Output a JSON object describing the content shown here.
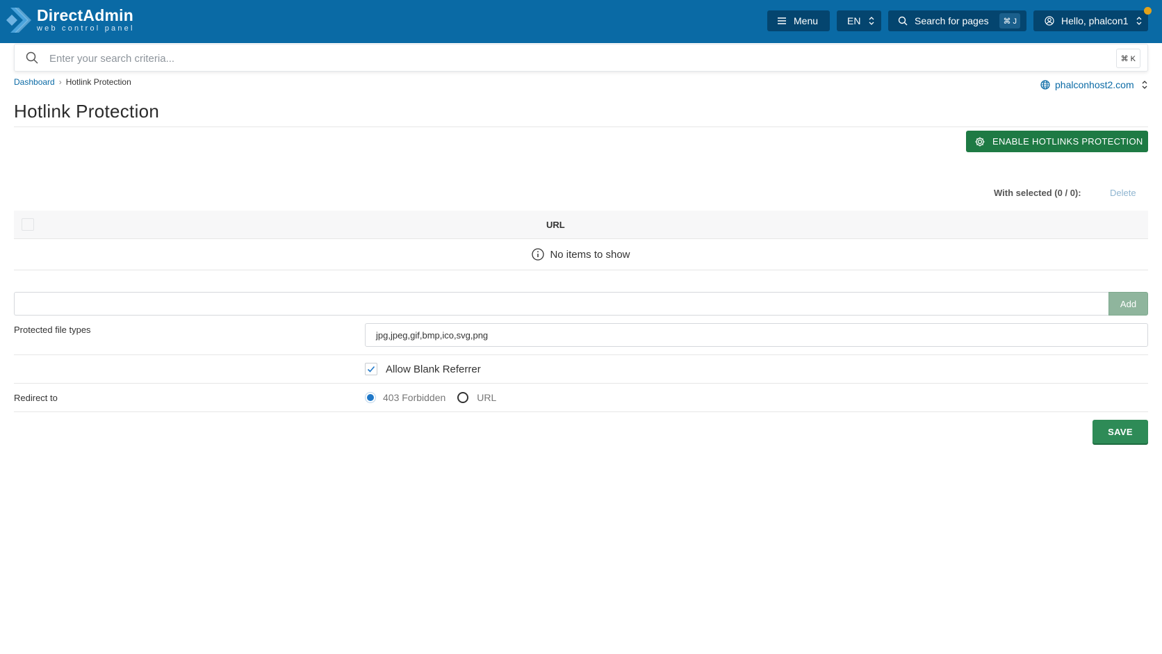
{
  "brand": {
    "title": "DirectAdmin",
    "subtitle": "web control panel"
  },
  "topbar": {
    "menu_label": "Menu",
    "language": "EN",
    "search_label": "Search for pages",
    "search_shortcut": "⌘ J",
    "user_greeting": "Hello, phalcon1",
    "accent_color": "#0a6aa5",
    "notification_color": "#e3a21a"
  },
  "global_search": {
    "placeholder": "Enter your search criteria...",
    "shortcut": "⌘ K"
  },
  "breadcrumb": {
    "home": "Dashboard",
    "current": "Hotlink Protection"
  },
  "domain_selector": {
    "value": "phalconhost2.com"
  },
  "page": {
    "title": "Hotlink Protection"
  },
  "actions": {
    "enable_label": "ENABLE HOTLINKS PROTECTION",
    "with_selected": "With selected (0 / 0):",
    "delete_label": "Delete"
  },
  "table": {
    "columns": [
      "URL"
    ],
    "empty_message": "No items to show"
  },
  "add_url": {
    "value": "",
    "button_label": "Add"
  },
  "form": {
    "file_types_label": "Protected file types",
    "file_types_value": "jpg,jpeg,gif,bmp,ico,svg,png",
    "blank_referrer_label": "Allow Blank Referrer",
    "blank_referrer_checked": true,
    "redirect_label": "Redirect to",
    "redirect_options": [
      "403 Forbidden",
      "URL"
    ],
    "redirect_selected": "403 Forbidden",
    "save_label": "SAVE"
  }
}
